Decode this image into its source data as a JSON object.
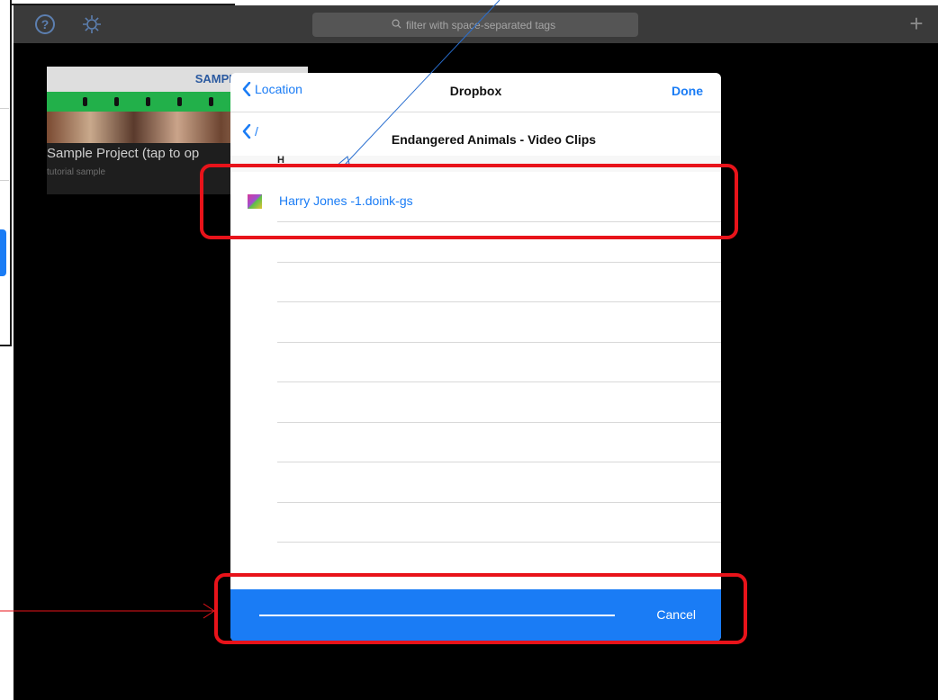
{
  "toolbar": {
    "search_placeholder": "filter with space-separated tags",
    "add_glyph": "+",
    "icons": [
      "help-icon",
      "gear-icon",
      "search-icon",
      "add-icon"
    ]
  },
  "project": {
    "thumb_title": "SAMPLE PROJEC",
    "name": "Sample Project (tap to op",
    "subtitle": "tutorial sample"
  },
  "modal": {
    "back_label": "Location",
    "title": "Dropbox",
    "done_label": "Done",
    "path_back_label": "/",
    "folder_title": "Endangered Animals - Video Clips",
    "section_header": "H",
    "files": [
      {
        "name": "Harry Jones -1.doink-gs"
      }
    ],
    "cancel_label": "Cancel"
  },
  "colors": {
    "accent": "#1a7cf5",
    "annotation_red": "#e8131a",
    "background": "#000000",
    "toolbar": "#3a3a3a"
  }
}
